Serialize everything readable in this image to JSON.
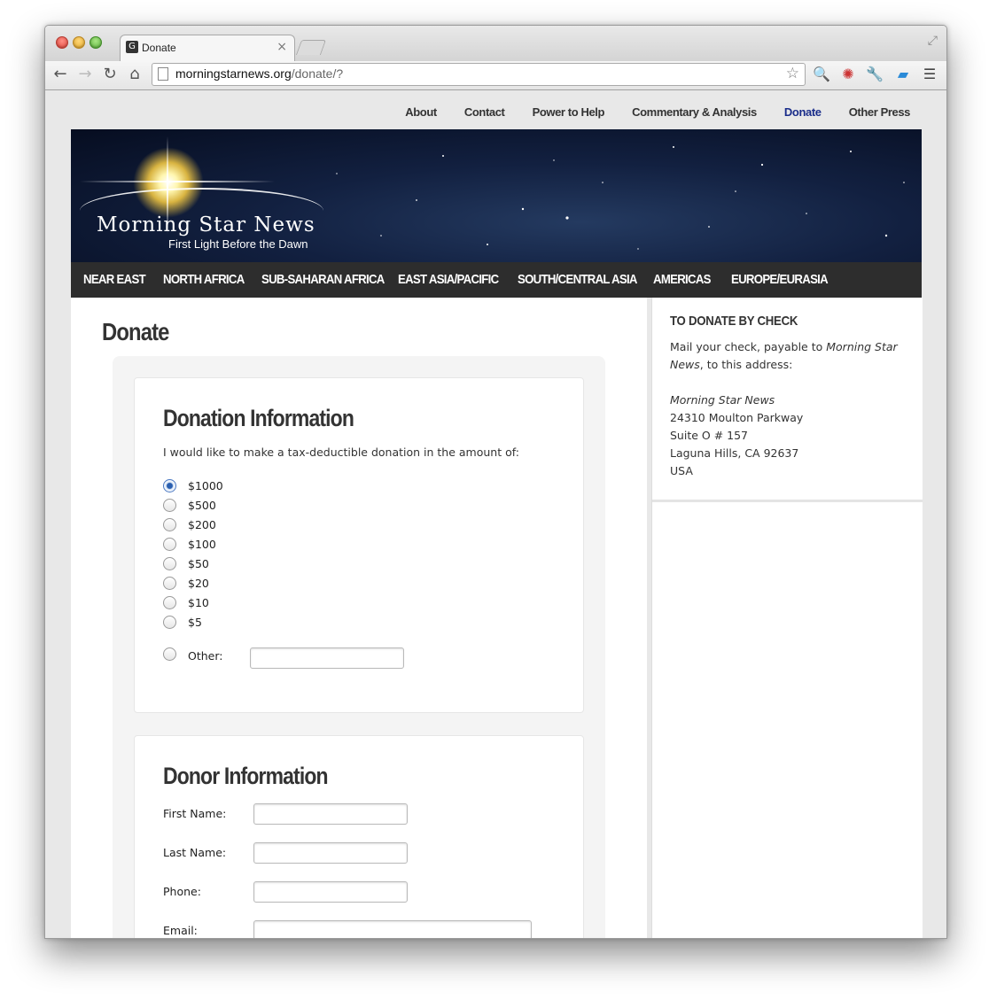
{
  "browser": {
    "tab_title": "Donate",
    "url_host": "morningstarnews.org",
    "url_path": "/donate/?"
  },
  "top_nav": [
    "About",
    "Contact",
    "Power to Help",
    "Commentary & Analysis",
    "Donate",
    "Other Press"
  ],
  "top_nav_active": "Donate",
  "logo": {
    "title": "Morning Star News",
    "subtitle": "First Light Before the Dawn"
  },
  "categories": [
    "NEAR EAST",
    "NORTH AFRICA",
    "SUB-SAHARAN AFRICA",
    "EAST ASIA/PACIFIC",
    "SOUTH/CENTRAL ASIA",
    "AMERICAS",
    "EUROPE/EURASIA"
  ],
  "page_title": "Donate",
  "donation": {
    "title": "Donation Information",
    "intro": "I would like to make a tax-deductible donation in the amount of:",
    "options": [
      "$1000",
      "$500",
      "$200",
      "$100",
      "$50",
      "$20",
      "$10",
      "$5"
    ],
    "selected": "$1000",
    "other_label": "Other:",
    "other_value": ""
  },
  "donor": {
    "title": "Donor Information",
    "first_name_label": "First Name:",
    "last_name_label": "Last Name:",
    "phone_label": "Phone:",
    "email_label": "Email:"
  },
  "sidebar": {
    "title": "TO DONATE BY CHECK",
    "line1": "Mail your check, payable to",
    "payee": "Morning Star News",
    "line1_end": ", to this address:",
    "address_name": "Morning Star News",
    "address": [
      "24310 Moulton Parkway",
      "Suite O # 157",
      "Laguna Hills, CA 92637",
      "USA"
    ]
  },
  "colors": {
    "active_link": "#1a2d8a",
    "category_bar": "#2d2d2d",
    "radio_selected": "#2a5fb0"
  }
}
